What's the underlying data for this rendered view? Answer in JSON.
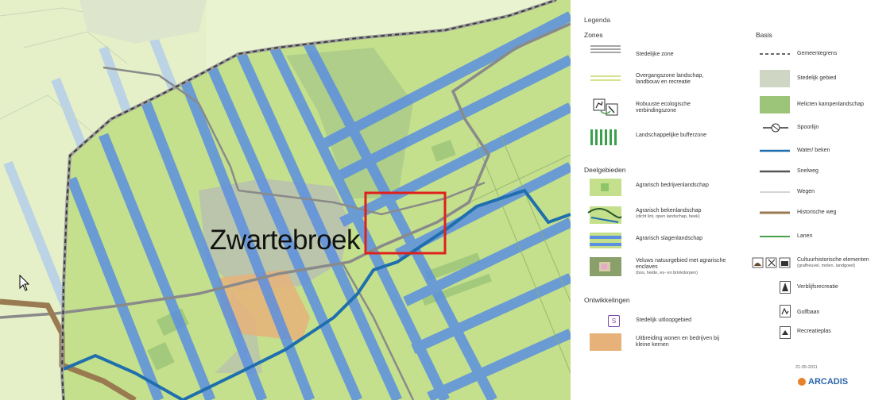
{
  "map": {
    "place_label": "Zwartebroek"
  },
  "legend": {
    "title": "Legenda",
    "zones": {
      "heading": "Zones",
      "items": [
        {
          "label": "Stedelijke zone",
          "icon": "urban-zone-lines"
        },
        {
          "label": "Overgangszone landschap, landbouw en recreatie",
          "icon": "transition-zone-lines"
        },
        {
          "label": "Robuuste ecologische verbindingszone",
          "icon": "deer-icon"
        },
        {
          "label": "Landschappelijke bufferzone",
          "icon": "buffer-zone-stripes"
        }
      ]
    },
    "deelgebieden": {
      "heading": "Deelgebieden",
      "items": [
        {
          "label": "Agrarisch bedrijvenlandschap",
          "note": ""
        },
        {
          "label": "Agrarisch bekenlandschap",
          "note": "(dicht lint, open landschap, beek)"
        },
        {
          "label": "Agrarisch slagenlandschap",
          "note": ""
        },
        {
          "label": "Veluws natuurgebied met agrarische enclaves",
          "note": "(bos, heide, es- en brinkdorpen)"
        }
      ]
    },
    "ontwikkelingen": {
      "heading": "Ontwikkelingen",
      "items": [
        {
          "label": "Stedelijk uitloopgebied",
          "symbol": "S"
        },
        {
          "label": "Uitbreiding wonen en bedrijven bij kleine kernen",
          "symbol": ""
        }
      ]
    },
    "basis": {
      "heading": "Basis",
      "items": [
        {
          "label": "Gemeentegrens",
          "note": ""
        },
        {
          "label": "Stedelijk gebied",
          "note": ""
        },
        {
          "label": "Relicten kampenlandschap",
          "note": ""
        },
        {
          "label": "Spoorlijn",
          "note": ""
        },
        {
          "label": "Water/ beken",
          "note": ""
        },
        {
          "label": "Snelweg",
          "note": ""
        },
        {
          "label": "Wegen",
          "note": ""
        },
        {
          "label": "Historische weg",
          "note": ""
        },
        {
          "label": "Lanen",
          "note": ""
        },
        {
          "label": "Cultuurhistorische elementen",
          "note": "(grafheuvel, molen, landgoed)"
        },
        {
          "label": "Verblijfsrecreatie",
          "note": ""
        },
        {
          "label": "Golfbaan",
          "note": ""
        },
        {
          "label": "Recreatieplas",
          "note": ""
        }
      ]
    },
    "date": "21-05-2011",
    "logo": "ARCADIS"
  },
  "colors": {
    "background_green": "#eaf3d0",
    "field_green": "#c4e08c",
    "urban_gray": "#b8bfb0",
    "slagen_blue": "#5b8fe0",
    "water_blue": "#1f6fae",
    "boundary": "#4a4a4a",
    "historic_road": "#9a7a50",
    "expansion_orange": "#e6b27a",
    "highlight_red": "#e0201c"
  }
}
